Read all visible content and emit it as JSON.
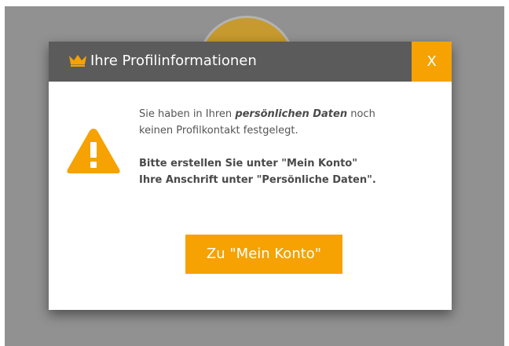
{
  "modal": {
    "title": "Ihre Profilinformationen",
    "close_label": "X",
    "header_icon": "crown-icon",
    "alert_icon": "warning-icon",
    "message": {
      "intro": "Sie haben in Ihren ",
      "emphasis": "persönlichen Daten",
      "line1_end": " noch",
      "line2": "keinen Profilkontakt festgelegt.",
      "instruction_line1": "Bitte erstellen Sie unter \"Mein Konto\"",
      "instruction_line2": "Ihre Anschrift unter \"Persönliche Daten\"."
    },
    "action_label": "Zu \"Mein Konto\""
  },
  "colors": {
    "accent": "#f5a202",
    "header_background": "#5b5b5b",
    "overlay": "#919191",
    "background_circle": "#c69a2e"
  }
}
